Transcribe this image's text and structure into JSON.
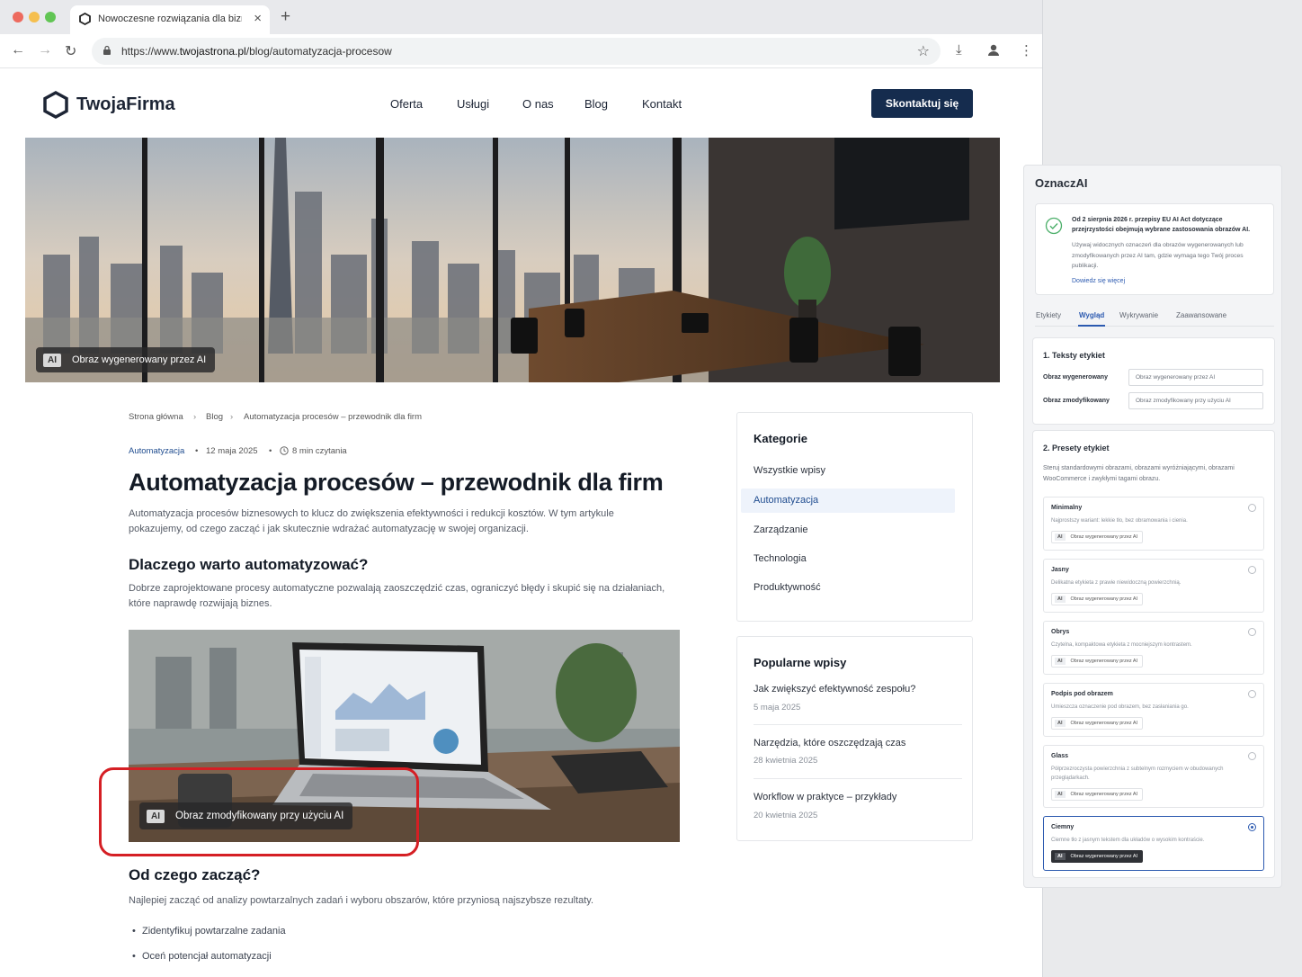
{
  "browser": {
    "tab_title": "Nowoczesne rozwiązania dla biznesu",
    "url_prefix": "https://www.",
    "url_domain": "twojastrona.pl",
    "url_path": "/blog/automatyzacja-procesow",
    "icons": [
      "back-arrow-icon",
      "forward-arrow-icon",
      "reload-icon",
      "lock-icon",
      "star-icon",
      "download-icon",
      "profile-icon",
      "more-icon"
    ]
  },
  "site": {
    "logo_text": "TwojaFirma",
    "nav": [
      "Oferta",
      "Usługi",
      "O nas",
      "Blog",
      "Kontakt"
    ],
    "cta": "Skontaktuj się"
  },
  "hero": {
    "ai_chip": "AI",
    "badge_text": "Obraz wygenerowany przez AI"
  },
  "article": {
    "breadcrumb": [
      "Strona główna",
      "Blog",
      "Automatyzacja procesów – przewodnik dla firm"
    ],
    "category": "Automatyzacja",
    "date": "12 maja 2025",
    "read_time": "8 min czytania",
    "title": "Automatyzacja procesów – przewodnik dla firm",
    "lead": "Automatyzacja procesów biznesowych to klucz do zwiększenia efektywności i redukcji kosztów. W tym artykule pokazujemy, od czego zacząć i jak skutecznie wdrażać automatyzację w swojej organizacji.",
    "h2_1": "Dlaczego warto automatyzować?",
    "p_1": "Dobrze zaprojektowane procesy automatyczne pozwalają zaoszczędzić czas, ograniczyć błędy i skupić się na działaniach, które naprawdę rozwijają biznes.",
    "image2_chip": "AI",
    "image2_badge": "Obraz zmodyfikowany przy użyciu AI",
    "h2_2": "Od czego zacząć?",
    "p_2": "Najlepiej zacząć od analizy powtarzalnych zadań i wyboru obszarów, które przyniosą najszybsze rezultaty.",
    "bullets": [
      "Zidentyfikuj powtarzalne zadania",
      "Oceń potencjał automatyzacji"
    ]
  },
  "sidebar": {
    "categories_title": "Kategorie",
    "categories": [
      "Wszystkie wpisy",
      "Automatyzacja",
      "Zarządzanie",
      "Technologia",
      "Produktywność"
    ],
    "active_category": "Automatyzacja",
    "popular_title": "Popularne wpisy",
    "popular": [
      {
        "title": "Jak zwiększyć efektywność zespołu?",
        "date": "5 maja 2025"
      },
      {
        "title": "Narzędzia, które oszczędzają czas",
        "date": "28 kwietnia 2025"
      },
      {
        "title": "Workflow w praktyce – przykłady",
        "date": "20 kwietnia 2025"
      }
    ]
  },
  "panel": {
    "title": "OznaczAI",
    "notice_bold": "Od 2 sierpnia 2026 r. przepisy EU AI Act dotyczące przejrzystości obejmują wybrane zastosowania obrazów AI.",
    "notice_text": "Używaj widocznych oznaczeń dla obrazów wygenerowanych lub zmodyfikowanych przez AI tam, gdzie wymaga tego Twój proces publikacji.",
    "notice_link": "Dowiedz się więcej",
    "tabs": [
      "Etykiety",
      "Wygląd",
      "Wykrywanie",
      "Zaawansowane"
    ],
    "active_tab": "Wygląd",
    "labels_section": {
      "title": "1. Teksty etykiet",
      "generated_label": "Obraz wygenerowany",
      "generated_value": "Obraz wygenerowany przez AI",
      "modified_label": "Obraz zmodyfikowany",
      "modified_value": "Obraz zmodyfikowany przy użyciu AI"
    },
    "presets_section": {
      "title": "2. Presety etykiet",
      "description": "Steruj standardowymi obrazami, obrazami wyróżniającymi, obrazami WooCommerce i zwykłymi tagami obrazu.",
      "badge_chip": "AI",
      "badge_text": "Obraz wygenerowany przez AI",
      "selected": "Ciemny",
      "presets": [
        {
          "name": "Minimalny",
          "desc": "Najprostszy wariant: lekkie tło, bez obramowania i cienia."
        },
        {
          "name": "Jasny",
          "desc": "Delikatna etykieta z prawie niewidoczną powierzchnią."
        },
        {
          "name": "Obrys",
          "desc": "Czytelna, kompaktowa etykieta z mocniejszym kontrastem."
        },
        {
          "name": "Podpis pod obrazem",
          "desc": "Umieszcza oznaczenie pod obrazem, bez zasłaniania go."
        },
        {
          "name": "Glass",
          "desc": "Półprzezroczysta powierzchnia z subtelnym rozmyciem w obudowanych przeglądarkach."
        },
        {
          "name": "Ciemny",
          "desc": "Ciemne tło z jasnym tekstem dla układów o wysokim kontraście."
        }
      ]
    }
  }
}
